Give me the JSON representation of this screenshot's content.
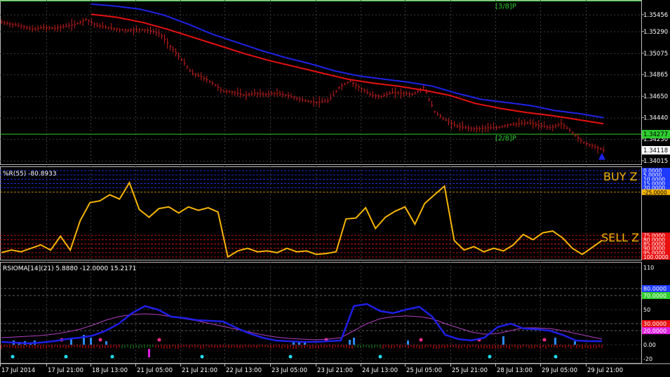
{
  "colors": {
    "background": "#000000",
    "grid": "#3a3a3a",
    "price": "#c81e1e",
    "ma_fast": "#e81010",
    "ma_slow": "#1e22e6",
    "pivot_line": "#2ecc2e",
    "wpr_line": "#f5b400",
    "rsioma_line": "#1e1ee6",
    "rsioma_signal": "#b040c0",
    "level_blue": "#1e3aff",
    "level_red": "#e81010",
    "level_orange": "#f5b400",
    "level_green": "#2ecc2e"
  },
  "main_panel": {
    "labels": {
      "upper_pivot": "[3/8]P",
      "lower_pivot": "[2/8]P",
      "arrow": "▲"
    },
    "price_ticks": [
      "1.35456",
      "1.35290",
      "1.35075",
      "1.34865",
      "1.34650",
      "1.34440",
      "1.34230",
      "1.34015"
    ],
    "current_price": "1.34118",
    "pivot_price": "1.34277"
  },
  "wpr_panel": {
    "title": "%R(55) -80.8933",
    "buy_zone_label": "BUY Z",
    "sell_zone_label": "SELL Z",
    "ticks": [
      "0.0000",
      "5.0000",
      "10.0000",
      "15.0000",
      "20.0000",
      "-25.0000",
      "75.0000",
      "80.0000",
      "85.0000",
      "90.0000",
      "95.0000",
      "100.0000"
    ],
    "level_values": [
      0,
      5,
      10,
      15,
      20,
      25,
      75,
      80,
      85,
      90,
      95,
      100
    ]
  },
  "rsioma_panel": {
    "title": "RSIOMA[14](21) 5.8880 -12.0000 15.2171",
    "ticks": [
      "110",
      "80.0000",
      "70.0000",
      "50",
      "30.0000",
      "20.0000",
      "0.00",
      "-20"
    ],
    "level_values": [
      110,
      80,
      70,
      50,
      30,
      20,
      0,
      -20
    ]
  },
  "time_axis": [
    "17 Jul 2014",
    "17 Jul 21:00",
    "18 Jul 13:00",
    "21 Jul 05:00",
    "21 Jul 21:00",
    "22 Jul 13:00",
    "23 Jul 05:00",
    "23 Jul 21:00",
    "24 Jul 13:00",
    "25 Jul 05:00",
    "25 Jul 21:00",
    "28 Jul 13:00",
    "29 Jul 05:00",
    "29 Jul 21:00"
  ],
  "chart_data": [
    {
      "type": "line",
      "series": [
        {
          "values": [
            1.3538,
            1.3536,
            1.3534,
            1.3531,
            1.3533,
            1.3532,
            1.3534,
            1.3536,
            1.3541,
            1.3535,
            1.3533,
            1.3531,
            1.353,
            1.3531,
            1.353,
            1.3527,
            1.3514,
            1.3502,
            1.3488,
            1.3484,
            1.3478,
            1.347,
            1.3469,
            1.3466,
            1.3468,
            1.3467,
            1.3468,
            1.3466,
            1.3463,
            1.346,
            1.3459,
            1.3461,
            1.3474,
            1.348,
            1.3473,
            1.3466,
            1.3465,
            1.3469,
            1.3468,
            1.3467,
            1.3474,
            1.345,
            1.3442,
            1.3436,
            1.3434,
            1.3433,
            1.3434,
            1.3434,
            1.3437,
            1.3438,
            1.3439,
            1.3436,
            1.3434,
            1.3438,
            1.343,
            1.342,
            1.3416,
            1.3412
          ]
        },
        {
          "values": [
            1.3556,
            1.3554,
            1.3551,
            1.3545,
            1.3536,
            1.3526,
            1.3518,
            1.351,
            1.3503,
            1.3497,
            1.349,
            1.3485,
            1.3482,
            1.3479,
            1.3475,
            1.3468,
            1.3462,
            1.3459,
            1.3456,
            1.3451,
            1.3448,
            1.3444
          ]
        },
        {
          "values": [
            1.3546,
            1.3543,
            1.3538,
            1.3531,
            1.3523,
            1.3515,
            1.3507,
            1.35,
            1.3494,
            1.3488,
            1.3482,
            1.3478,
            1.3475,
            1.3471,
            1.3466,
            1.3458,
            1.3453,
            1.3449,
            1.3446,
            1.3442,
            1.3438
          ]
        }
      ],
      "ylim": [
        1.3398,
        1.356
      ]
    },
    {
      "type": "line",
      "series": [
        {
          "values": [
            -95,
            -92,
            -94,
            -90,
            -86,
            -92,
            -76,
            -92,
            -58,
            -37,
            -35,
            -28,
            -33,
            -14,
            -45,
            -54,
            -44,
            -42,
            -49,
            -42,
            -46,
            -43,
            -48,
            -100,
            -93,
            -90,
            -94,
            -93,
            -95,
            -90,
            -94,
            -93,
            -97,
            -96,
            -94,
            -56,
            -55,
            -43,
            -67,
            -54,
            -47,
            -42,
            -62,
            -38,
            -28,
            -18,
            -81,
            -92,
            -88,
            -94,
            -90,
            -93,
            -86,
            -74,
            -80,
            -72,
            -70,
            -78,
            -90,
            -97,
            -89,
            -81
          ]
        }
      ],
      "ylim": [
        -100,
        0
      ]
    },
    {
      "type": "line",
      "series": [
        {
          "values": [
            4,
            3,
            2,
            3,
            5,
            8,
            10,
            13,
            20,
            30,
            45,
            55,
            50,
            40,
            38,
            35,
            34,
            33,
            24,
            16,
            10,
            6,
            5,
            4,
            4,
            5,
            6,
            55,
            58,
            48,
            45,
            50,
            54,
            40,
            14,
            8,
            6,
            10,
            25,
            30,
            23,
            22,
            20,
            14,
            6,
            5,
            5
          ]
        },
        {
          "values": [
            10,
            11,
            12,
            13,
            15,
            18,
            22,
            28,
            35,
            40,
            43,
            44,
            43,
            40,
            37,
            34,
            30,
            26,
            22,
            18,
            14,
            11,
            9,
            8,
            7,
            8,
            10,
            20,
            30,
            37,
            40,
            41,
            40,
            37,
            30,
            24,
            18,
            15,
            16,
            20,
            24,
            24,
            23,
            20,
            16,
            12,
            8
          ]
        }
      ],
      "ylim": [
        -20,
        110
      ]
    }
  ]
}
